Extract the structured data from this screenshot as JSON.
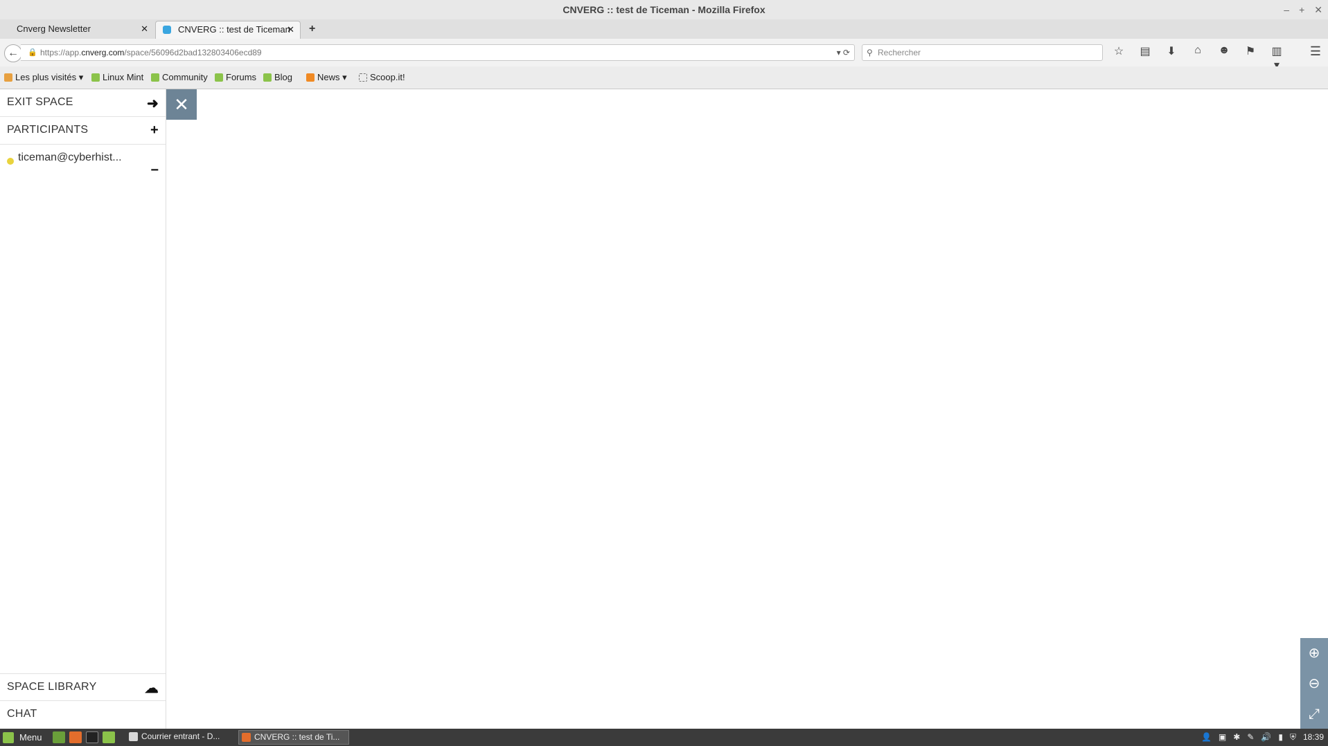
{
  "window": {
    "title": "CNVERG :: test de Ticeman - Mozilla Firefox",
    "controls": [
      "–",
      "+",
      "✕"
    ]
  },
  "tabs": [
    {
      "label": "Cnverg Newsletter",
      "close": "✕"
    },
    {
      "label": "CNVERG :: test de Ticeman",
      "close": "✕"
    }
  ],
  "newtab_label": "+",
  "nav": {
    "back": "←",
    "url_prefix": "https://app.",
    "url_host": "cnverg.com",
    "url_path": "/space/56096d2bad132803406ecd89",
    "url_tools": "▾ ⟳",
    "search_placeholder": "Rechercher",
    "icons": [
      "☆",
      "▤",
      "⬇",
      "⌂",
      "☻",
      "⚑",
      "▥ ▾"
    ],
    "menu": "☰"
  },
  "bookmarks": [
    {
      "label": "Les plus visités ▾"
    },
    {
      "label": "Linux Mint"
    },
    {
      "label": "Community"
    },
    {
      "label": "Forums"
    },
    {
      "label": "Blog"
    },
    {
      "label": "News ▾"
    },
    {
      "label": "Scoop.it!"
    }
  ],
  "sidebar": {
    "exit_space": "EXIT SPACE",
    "participants": "PARTICIPANTS",
    "participant_name": "ticeman@cyberhist...",
    "space_library": "SPACE LIBRARY",
    "chat": "CHAT",
    "add_icon": "+",
    "remove_icon": "−",
    "exit_icon": "➜",
    "upload_icon": "☁"
  },
  "canvas": {
    "close_icon": "✕",
    "zoom_in_icon": "⊕",
    "zoom_out_icon": "⊖",
    "fullscreen_icon": "⤢"
  },
  "taskbar": {
    "menu_label": "Menu",
    "tasks": [
      {
        "label": "Courrier entrant - D..."
      },
      {
        "label": "CNVERG :: test de Ti..."
      }
    ],
    "clock": "18:39",
    "tray_icons": [
      "👤",
      "▣",
      "✱",
      "✎",
      "🔊",
      "▮",
      "⛨"
    ]
  }
}
